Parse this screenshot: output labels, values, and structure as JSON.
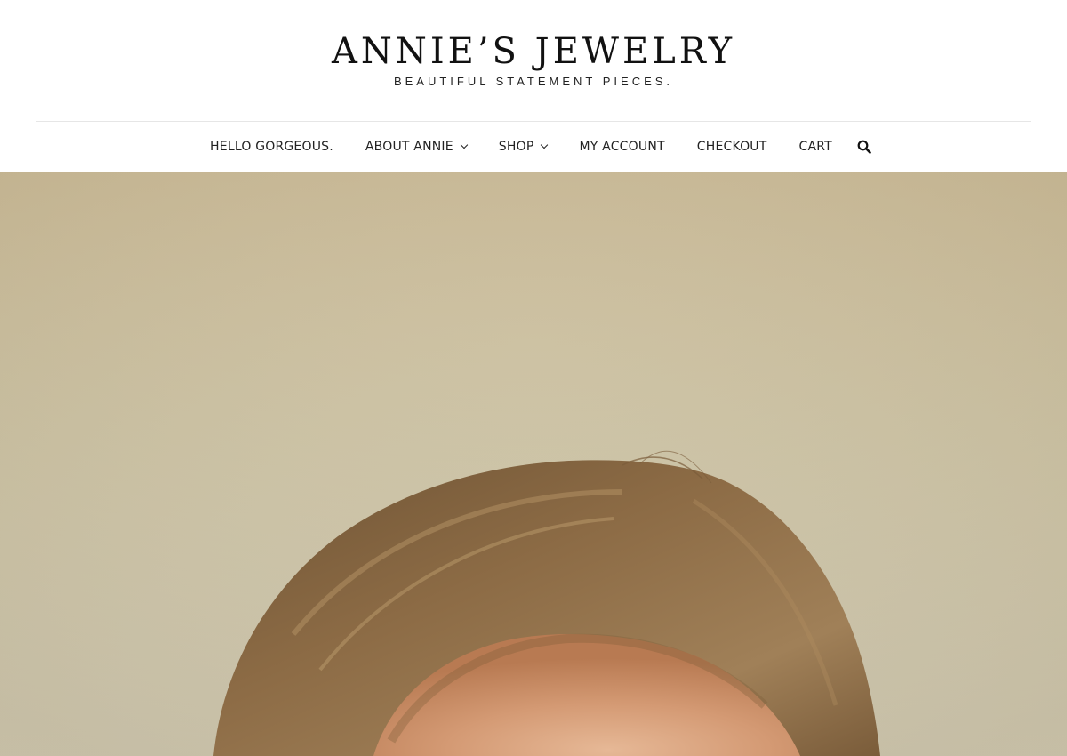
{
  "brand": {
    "title": "ANNIE’S JEWELRY",
    "tagline": "BEAUTIFUL STATEMENT PIECES."
  },
  "nav": {
    "items": [
      {
        "label": "HELLO GORGEOUS."
      },
      {
        "label": "ABOUT ANNIE"
      },
      {
        "label": "SHOP"
      },
      {
        "label": "MY ACCOUNT"
      },
      {
        "label": "CHECKOUT"
      },
      {
        "label": "CART"
      }
    ],
    "search_icon": "search-icon"
  },
  "colors": {
    "text": "#222222",
    "wall": "#c9bd9d",
    "hair": "#8a6a44"
  }
}
